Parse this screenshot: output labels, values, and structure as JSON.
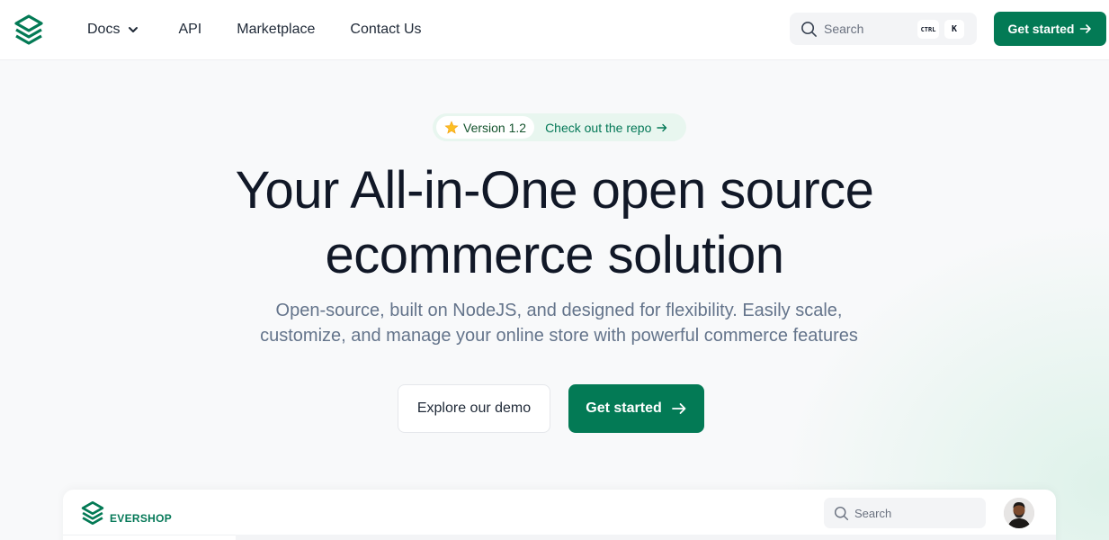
{
  "header": {
    "logo_icon": "evershop-logo-icon",
    "nav": [
      {
        "label": "Docs",
        "has_dropdown": true
      },
      {
        "label": "API"
      },
      {
        "label": "Marketplace"
      },
      {
        "label": "Contact Us"
      }
    ],
    "search": {
      "placeholder": "Search",
      "shortcut_ctrl": "CTRL",
      "shortcut_key": "K"
    },
    "cta_label": "Get started"
  },
  "hero": {
    "badge_version": "Version 1.2",
    "badge_link": "Check out the repo",
    "title_line1": "Your All-in-One open source",
    "title_line2": "ecommerce solution",
    "subtitle_line1": "Open-source, built on NodeJS, and designed for flexibility. Easily scale,",
    "subtitle_line2": "customize, and manage your online store with powerful commerce features",
    "demo_label": "Explore our demo",
    "start_label": "Get started"
  },
  "preview": {
    "brand": "EVERSHOP",
    "search_placeholder": "Search"
  },
  "colors": {
    "brand_green": "#037a55",
    "badge_bg": "#e8f6ef",
    "text_dark": "#111827",
    "text_muted": "#64748b"
  }
}
